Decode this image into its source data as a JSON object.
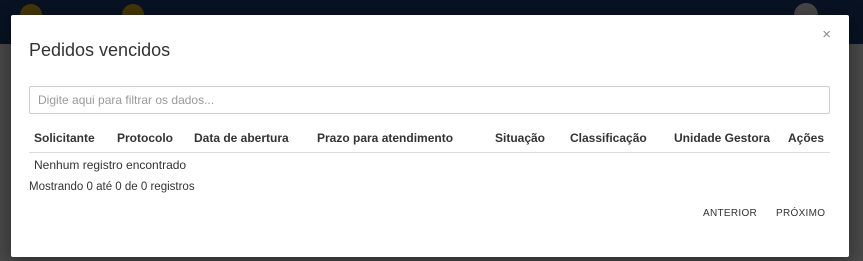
{
  "modal": {
    "title": "Pedidos vencidos",
    "close_glyph": "×",
    "filter_placeholder": "Digite aqui para filtrar os dados..."
  },
  "table": {
    "columns": [
      "Solicitante",
      "Protocolo",
      "Data de abertura",
      "Prazo para atendimento",
      "Situação",
      "Classificação",
      "Unidade Gestora",
      "Ações"
    ],
    "empty_message": "Nenhum registro encontrado"
  },
  "footer": {
    "info": "Mostrando 0 até 0 de 0 registros",
    "prev_label": "ANTERIOR",
    "next_label": "PRÓXIMO"
  },
  "colors": {
    "header_bg": "#1c3d74",
    "logo_yellow": "#e4b51b"
  }
}
